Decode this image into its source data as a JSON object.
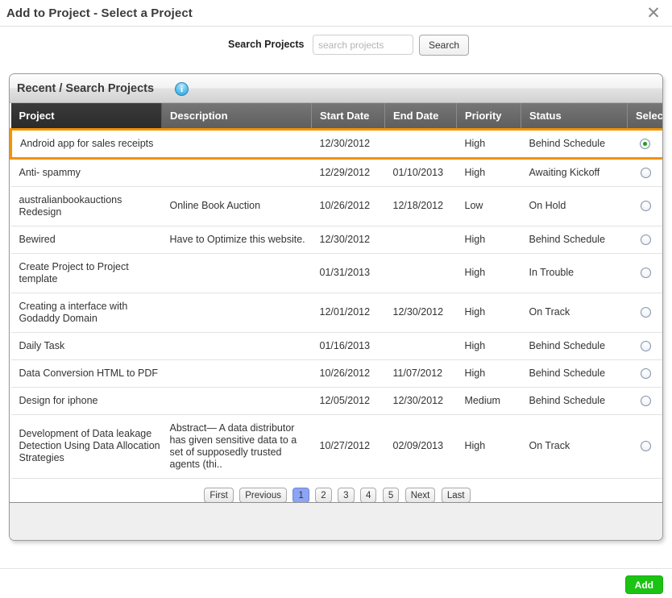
{
  "dialog": {
    "title": "Add to Project - Select a Project",
    "close_label": "✕"
  },
  "search": {
    "label": "Search Projects",
    "placeholder": "search projects",
    "value": "",
    "button_label": "Search"
  },
  "panel": {
    "title": "Recent / Search Projects",
    "info_glyph": "i"
  },
  "table": {
    "columns": [
      "Project",
      "Description",
      "Start Date",
      "End Date",
      "Priority",
      "Status",
      "Select"
    ],
    "rows": [
      {
        "project": "Android app for sales receipts",
        "description": "",
        "start_date": "12/30/2012",
        "end_date": "",
        "priority": "High",
        "status": "Behind Schedule",
        "selected": true
      },
      {
        "project": "Anti- spammy",
        "description": "",
        "start_date": "12/29/2012",
        "end_date": "01/10/2013",
        "priority": "High",
        "status": "Awaiting Kickoff",
        "selected": false
      },
      {
        "project": "australianbookauctions Redesign",
        "description": "Online Book Auction",
        "start_date": "10/26/2012",
        "end_date": "12/18/2012",
        "priority": "Low",
        "status": "On Hold",
        "selected": false
      },
      {
        "project": "Bewired",
        "description": "Have to Optimize this website.",
        "start_date": "12/30/2012",
        "end_date": "",
        "priority": "High",
        "status": "Behind Schedule",
        "selected": false
      },
      {
        "project": "Create Project to Project template",
        "description": "",
        "start_date": "01/31/2013",
        "end_date": "",
        "priority": "High",
        "status": "In Trouble",
        "selected": false
      },
      {
        "project": "Creating a interface with Godaddy Domain",
        "description": "",
        "start_date": "12/01/2012",
        "end_date": "12/30/2012",
        "priority": "High",
        "status": "On Track",
        "selected": false
      },
      {
        "project": "Daily Task",
        "description": "",
        "start_date": "01/16/2013",
        "end_date": "",
        "priority": "High",
        "status": "Behind Schedule",
        "selected": false
      },
      {
        "project": "Data Conversion HTML to PDF",
        "description": "",
        "start_date": "10/26/2012",
        "end_date": "11/07/2012",
        "priority": "High",
        "status": "Behind Schedule",
        "selected": false
      },
      {
        "project": "Design for iphone",
        "description": "",
        "start_date": "12/05/2012",
        "end_date": "12/30/2012",
        "priority": "Medium",
        "status": "Behind Schedule",
        "selected": false
      },
      {
        "project": "Development of Data leakage Detection Using Data Allocation Strategies",
        "description": "Abstract— A data distributor has given sensitive data to a set\nof supposedly trusted agents (thi..",
        "start_date": "10/27/2012",
        "end_date": "02/09/2013",
        "priority": "High",
        "status": "On Track",
        "selected": false
      }
    ]
  },
  "pagination": {
    "first": "First",
    "previous": "Previous",
    "pages": [
      "1",
      "2",
      "3",
      "4",
      "5"
    ],
    "active_page": "1",
    "next": "Next",
    "last": "Last"
  },
  "footer": {
    "add_label": "Add"
  },
  "colors": {
    "selected_row_outline": "#f39200",
    "add_button": "#1bc413",
    "active_page": "#8ca4f4",
    "radio_dot": "#19a11a",
    "header_dark": "#2b2b2b",
    "header_gray": "#5e5e5e"
  }
}
